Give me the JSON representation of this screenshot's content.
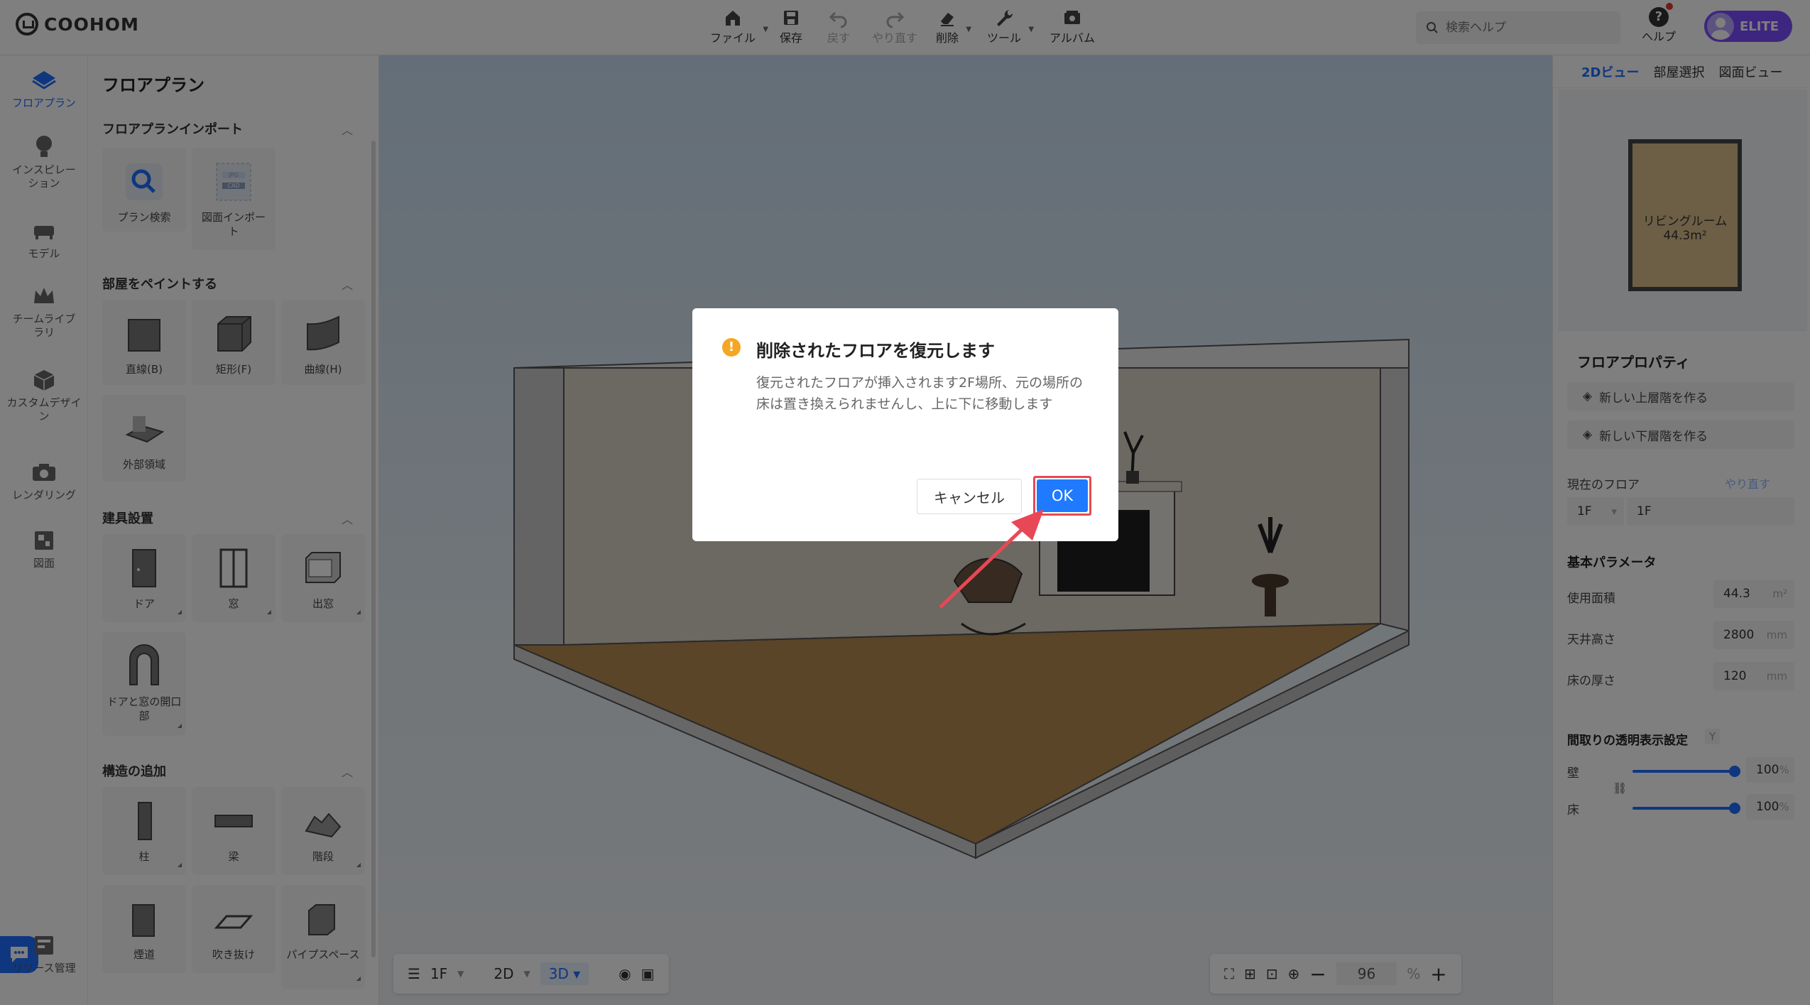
{
  "app": {
    "logo": "COOHOM"
  },
  "toolbar": {
    "items": [
      {
        "label": "ファイル",
        "icon": "home-icon"
      },
      {
        "label": "保存",
        "icon": "save-icon"
      },
      {
        "label": "戻す",
        "icon": "undo-icon"
      },
      {
        "label": "やり直す",
        "icon": "redo-icon"
      },
      {
        "label": "削除",
        "icon": "eraser-icon"
      },
      {
        "label": "ツール",
        "icon": "wrench-icon"
      },
      {
        "label": "アルバム",
        "icon": "album-icon"
      }
    ],
    "search_placeholder": "検索ヘルプ",
    "help_label": "ヘルプ",
    "badge": "ELITE"
  },
  "leftnav": {
    "items": [
      {
        "label": "フロアプラン",
        "active": true
      },
      {
        "label": "インスピレーション"
      },
      {
        "label": "モデル"
      },
      {
        "label": "チームライブラリ"
      },
      {
        "label": "カスタムデザイン"
      },
      {
        "label": "レンダリング"
      },
      {
        "label": "図面"
      }
    ],
    "resource": "リソース管理"
  },
  "leftpanel": {
    "title": "フロアプラン",
    "sections": [
      {
        "title": "フロアプランインポート",
        "tiles": [
          "プラン検索",
          "図面インポート"
        ]
      },
      {
        "title": "部屋をペイントする",
        "tiles": [
          "直線(B)",
          "矩形(F)",
          "曲線(H)",
          "外部領域"
        ]
      },
      {
        "title": "建具設置",
        "tiles": [
          "ドア",
          "窓",
          "出窓",
          "ドアと窓の開口部"
        ]
      },
      {
        "title": "構造の追加",
        "tiles": [
          "柱",
          "梁",
          "階段",
          "煙道",
          "吹き抜け",
          "パイプスペース"
        ]
      }
    ],
    "thumb_jpg": "JPG",
    "thumb_cad": "CAD"
  },
  "canvas": {
    "floor": "1F",
    "view2d": "2D",
    "view3d": "3D",
    "zoom": "96",
    "zoom_unit": "%"
  },
  "rightpanel": {
    "tabs": [
      "2Dビュー",
      "部屋選択",
      "図面ビュー"
    ],
    "room_name": "リビングルーム",
    "room_area": "44.3m²",
    "floor_props_title": "フロアプロパティ",
    "new_upper": "新しい上層階を作る",
    "new_lower": "新しい下層階を作る",
    "current_floor_label": "現在のフロア",
    "redo_link": "やり直す",
    "floor_select": "1F",
    "floor_name": "1F",
    "basic_params_title": "基本パラメータ",
    "area_label": "使用面積",
    "area_value": "44.3",
    "area_unit": "m²",
    "ceiling_label": "天井高さ",
    "ceiling_value": "2800",
    "ceiling_unit": "mm",
    "floor_thickness_label": "床の厚さ",
    "floor_thickness_value": "120",
    "floor_thickness_unit": "mm",
    "transparency_title": "間取りの透明表示設定",
    "transparency_key": "Y",
    "wall_label": "壁",
    "wall_value": "100",
    "wall_level": 1.0,
    "floor_label": "床",
    "floor_value": "100",
    "floor_level": 1.0,
    "percent": "%"
  },
  "dialog": {
    "title": "削除されたフロアを復元します",
    "body": "復元されたフロアが挿入されます2F場所、元の場所の床は置き換えられませんし、上に下に移動します",
    "cancel": "キャンセル",
    "ok": "OK"
  },
  "colors": {
    "accent": "#1f7aff",
    "highlight": "#e84855",
    "warning": "#f5a623",
    "elite": "#7b4dff"
  }
}
